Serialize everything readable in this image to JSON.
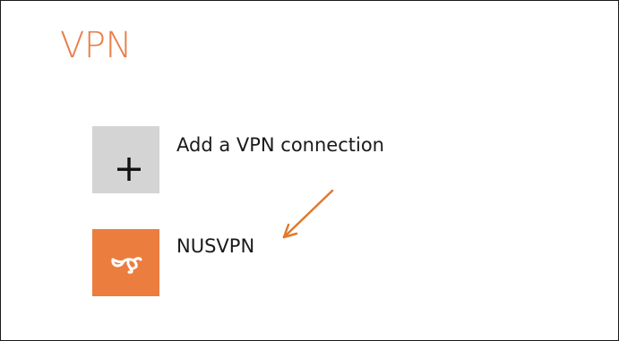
{
  "page": {
    "title": "VPN"
  },
  "items": [
    {
      "label": "Add a VPN connection",
      "icon": "plus-icon"
    },
    {
      "label": "NUSVPN",
      "icon": "vpn-connection-icon"
    }
  ],
  "colors": {
    "accent": "#e97e49",
    "add_tile": "#d4d4d4",
    "connection_tile": "#eb7d3f",
    "annotation_arrow": "#e07a2f"
  },
  "annotation": {
    "type": "arrow",
    "target": "NUSVPN"
  }
}
